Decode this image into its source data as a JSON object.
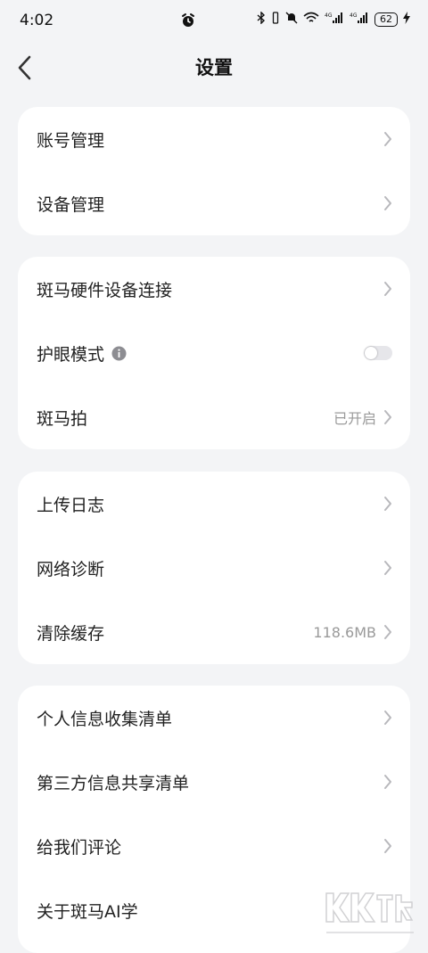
{
  "status_bar": {
    "time": "4:02",
    "battery": "62"
  },
  "header": {
    "title": "设置"
  },
  "groups": [
    {
      "items": [
        {
          "label": "账号管理"
        },
        {
          "label": "设备管理"
        }
      ]
    },
    {
      "items": [
        {
          "label": "斑马硬件设备连接"
        },
        {
          "label": "护眼模式",
          "toggle_on": false
        },
        {
          "label": "斑马拍",
          "value": "已开启"
        }
      ]
    },
    {
      "items": [
        {
          "label": "上传日志"
        },
        {
          "label": "网络诊断"
        },
        {
          "label": "清除缓存",
          "value": "118.6MB"
        }
      ]
    },
    {
      "items": [
        {
          "label": "个人信息收集清单"
        },
        {
          "label": "第三方信息共享清单"
        },
        {
          "label": "给我们评论"
        },
        {
          "label": "关于斑马AI学"
        }
      ]
    }
  ],
  "colors": {
    "background": "#f3f4f6",
    "card": "#ffffff",
    "muted_text": "#9a9a9a",
    "chevron": "#b8b8bc"
  },
  "icons": {
    "back": "chevron-left-icon",
    "row_arrow": "chevron-right-icon",
    "info": "info-circle-icon",
    "alarm": "alarm-icon"
  },
  "watermark": {
    "brand": "KK下载",
    "url": "www.kkx.net"
  }
}
